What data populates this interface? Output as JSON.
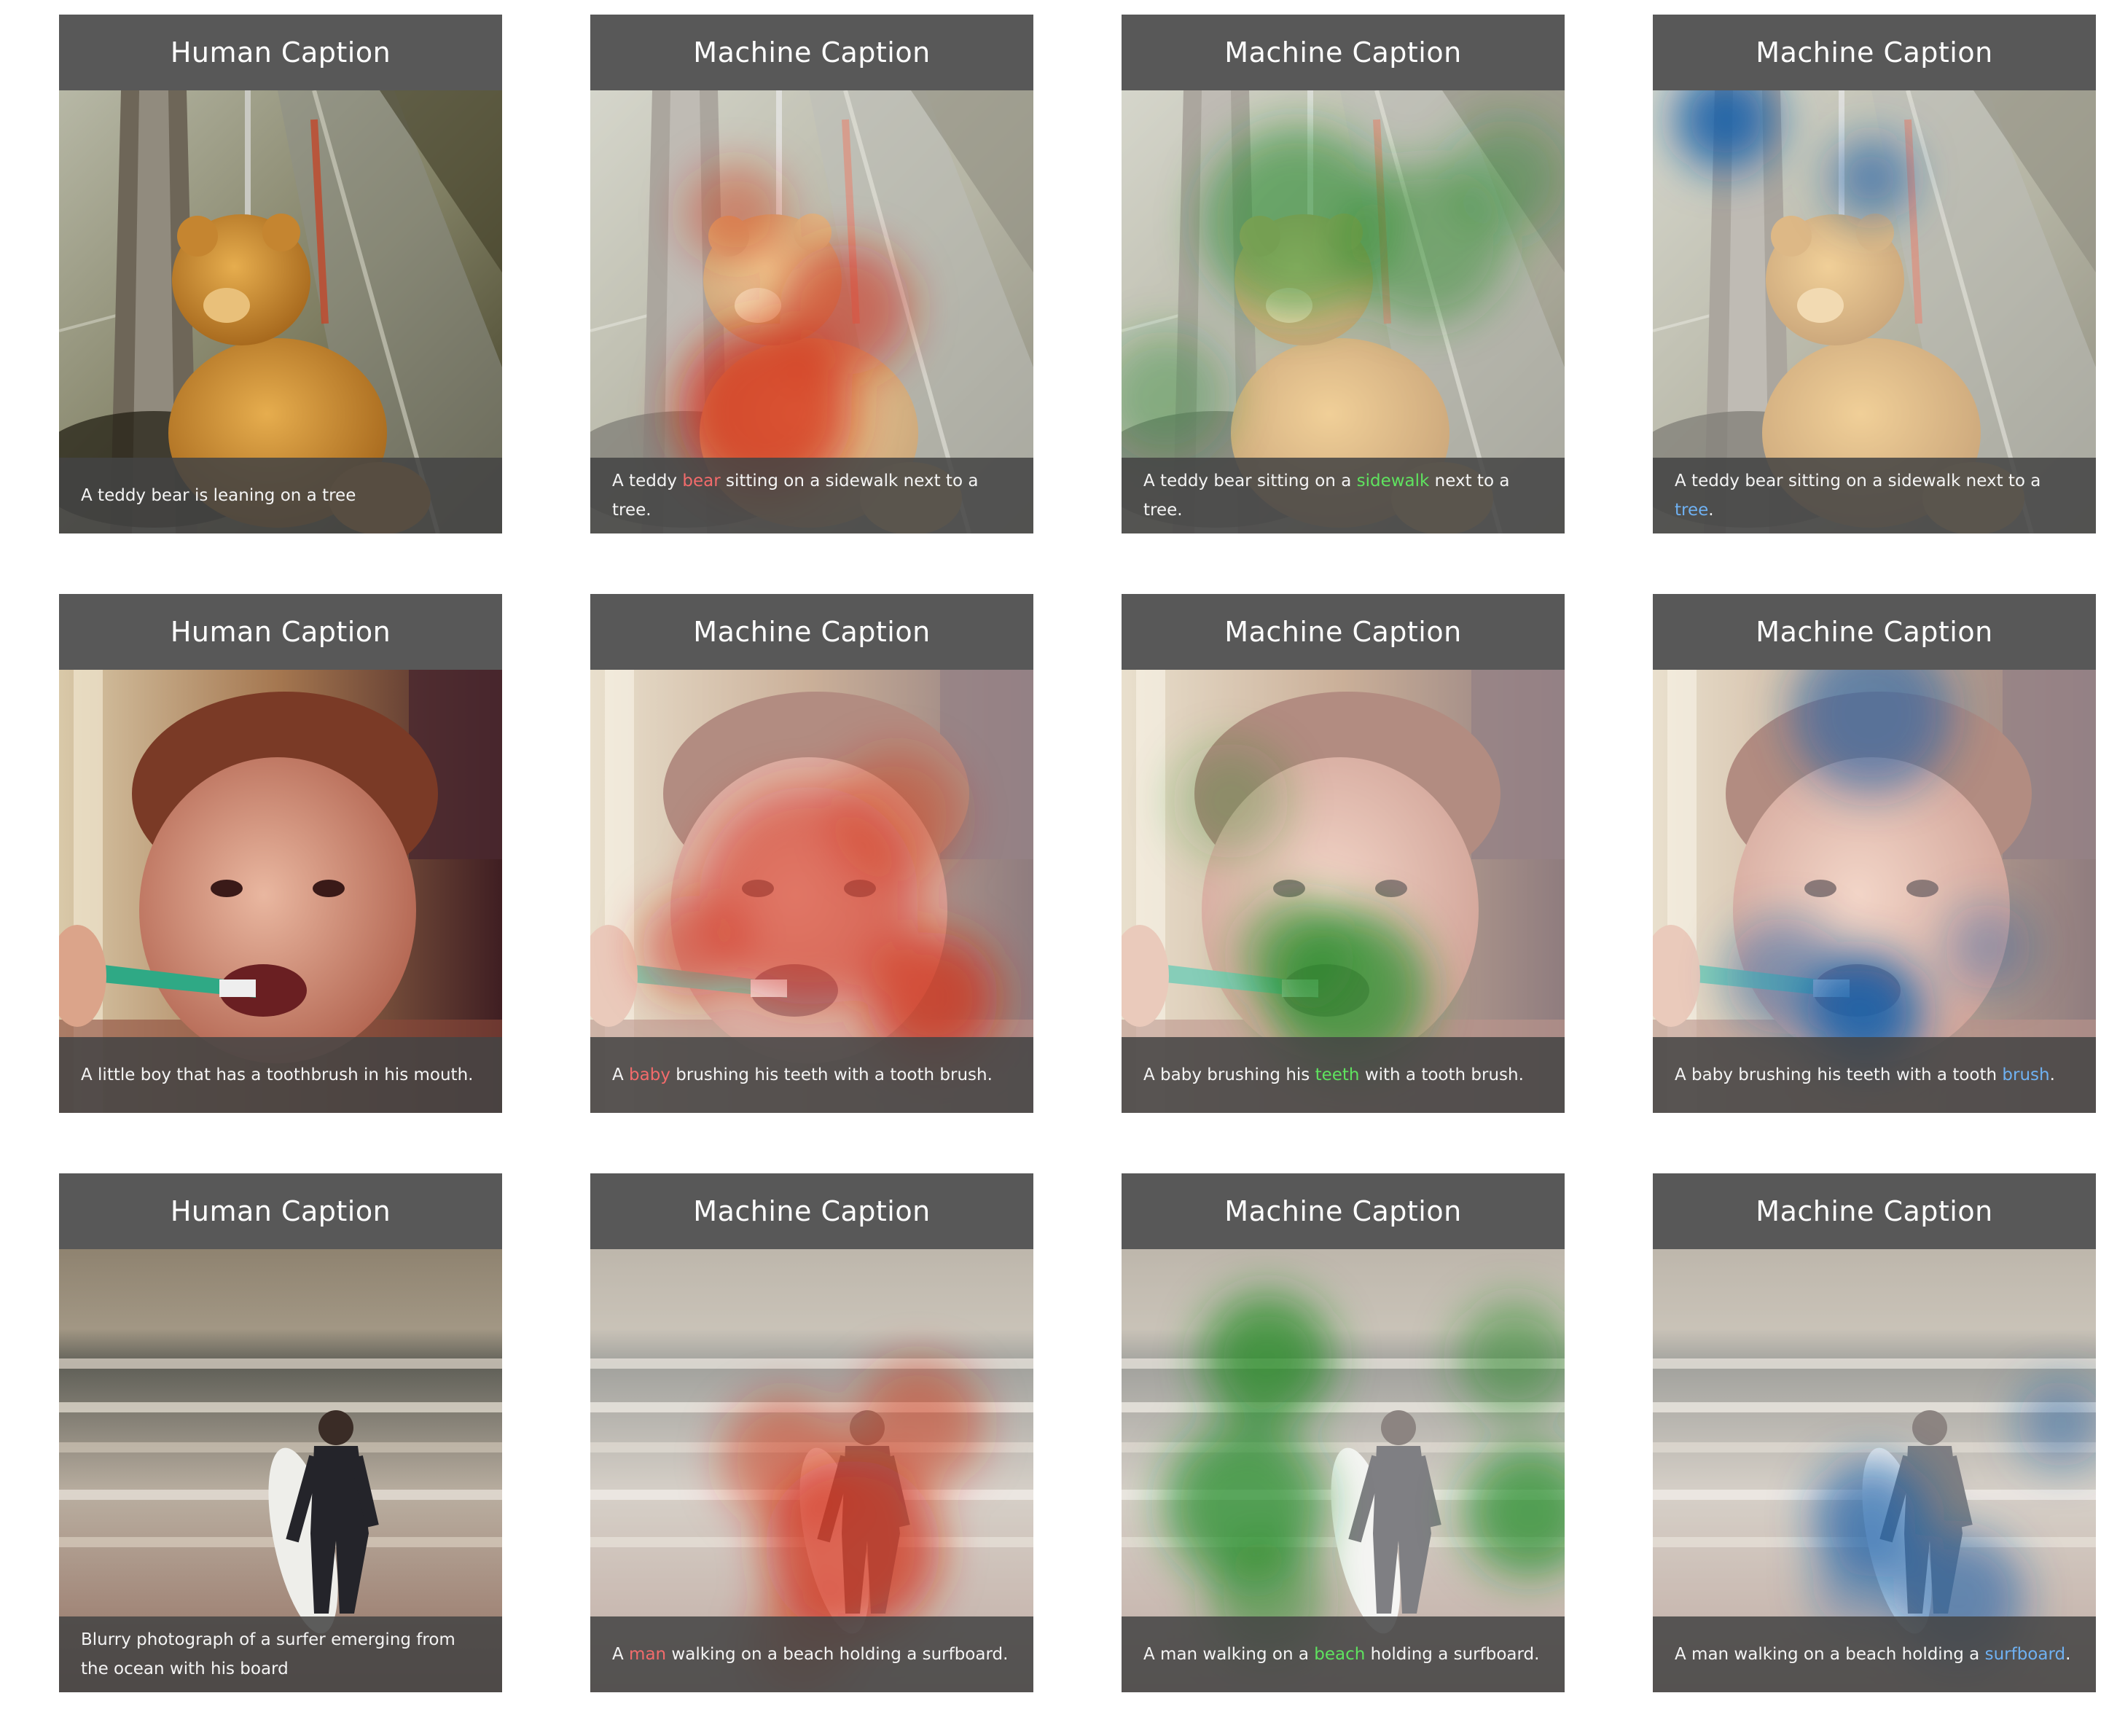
{
  "figure": {
    "rows": [
      {
        "scene": "teddy",
        "cards": [
          {
            "header": "Human Caption",
            "overlay": null,
            "caption": [
              {
                "text": "A teddy bear is leaning on a tree"
              }
            ]
          },
          {
            "header": "Machine Caption",
            "overlay": "red",
            "caption": [
              {
                "text": "A teddy "
              },
              {
                "text": "bear",
                "hl": "red"
              },
              {
                "text": " sitting on a sidewalk next to a tree."
              }
            ]
          },
          {
            "header": "Machine Caption",
            "overlay": "green",
            "caption": [
              {
                "text": "A teddy bear sitting on a "
              },
              {
                "text": "sidewalk",
                "hl": "green"
              },
              {
                "text": " next to a tree."
              }
            ]
          },
          {
            "header": "Machine Caption",
            "overlay": "blue",
            "caption": [
              {
                "text": "A teddy bear sitting on a sidewalk next to a "
              },
              {
                "text": "tree",
                "hl": "blue"
              },
              {
                "text": "."
              }
            ]
          }
        ]
      },
      {
        "scene": "child",
        "cards": [
          {
            "header": "Human Caption",
            "overlay": null,
            "caption": [
              {
                "text": "A little boy that has a toothbrush in his mouth."
              }
            ]
          },
          {
            "header": "Machine Caption",
            "overlay": "red",
            "caption": [
              {
                "text": "A "
              },
              {
                "text": "baby",
                "hl": "red"
              },
              {
                "text": " brushing his teeth with a tooth brush."
              }
            ]
          },
          {
            "header": "Machine Caption",
            "overlay": "green",
            "caption": [
              {
                "text": "A baby brushing his "
              },
              {
                "text": "teeth",
                "hl": "green"
              },
              {
                "text": " with a tooth brush."
              }
            ]
          },
          {
            "header": "Machine Caption",
            "overlay": "blue",
            "caption": [
              {
                "text": "A baby brushing his teeth with a tooth "
              },
              {
                "text": "brush",
                "hl": "blue"
              },
              {
                "text": "."
              }
            ]
          }
        ]
      },
      {
        "scene": "surfer",
        "cards": [
          {
            "header": "Human Caption",
            "overlay": null,
            "caption": [
              {
                "text": "Blurry photograph of a surfer emerging from the ocean with his board"
              }
            ]
          },
          {
            "header": "Machine Caption",
            "overlay": "red",
            "caption": [
              {
                "text": "A "
              },
              {
                "text": "man",
                "hl": "red"
              },
              {
                "text": " walking on a beach holding a surfboard."
              }
            ]
          },
          {
            "header": "Machine Caption",
            "overlay": "green",
            "caption": [
              {
                "text": "A man walking on a "
              },
              {
                "text": "beach",
                "hl": "green"
              },
              {
                "text": " holding a surfboard."
              }
            ]
          },
          {
            "header": "Machine Caption",
            "overlay": "blue",
            "caption": [
              {
                "text": "A man walking on a beach holding a "
              },
              {
                "text": "surfboard",
                "hl": "blue"
              },
              {
                "text": "."
              }
            ]
          }
        ]
      }
    ]
  },
  "colors": {
    "header_bg": "#585858",
    "caption_bg": "#444444",
    "caption_text": "#f4f4f4",
    "red": "#f26b6b",
    "green": "#5fe35f",
    "blue": "#6fb1f2"
  }
}
